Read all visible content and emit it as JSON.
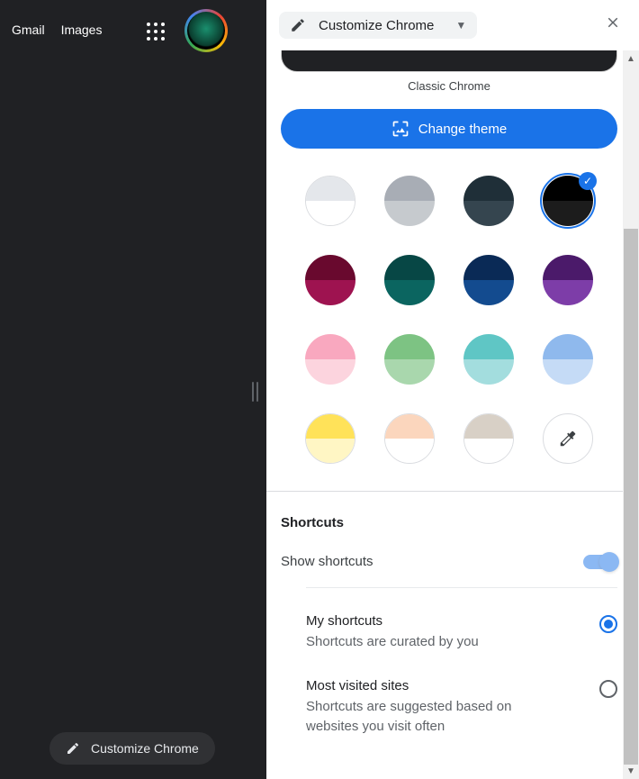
{
  "topnav": {
    "gmail": "Gmail",
    "images": "Images"
  },
  "customize_pill": "Customize Chrome",
  "panel": {
    "header_label": "Customize Chrome",
    "caption": "Classic Chrome",
    "change_theme": "Change theme",
    "shortcuts_title": "Shortcuts",
    "show_shortcuts": "Show shortcuts",
    "options": {
      "my_shortcuts_title": "My shortcuts",
      "my_shortcuts_desc": "Shortcuts are curated by you",
      "most_visited_title": "Most visited sites",
      "most_visited_desc": "Shortcuts are suggested based on websites you visit often"
    }
  },
  "swatches": [
    {
      "top": "#e4e7eb",
      "bot": "#ffffff",
      "outlined": true,
      "selected": false
    },
    {
      "top": "#a8adb5",
      "bot": "#c6cace",
      "outlined": false,
      "selected": false
    },
    {
      "top": "#1f2f38",
      "bot": "#35454f",
      "outlined": false,
      "selected": false
    },
    {
      "top": "#000000",
      "bot": "#1c1c1c",
      "outlined": false,
      "selected": true
    },
    {
      "top": "#69092e",
      "bot": "#9e1350",
      "outlined": false,
      "selected": false
    },
    {
      "top": "#074745",
      "bot": "#0b6560",
      "outlined": false,
      "selected": false
    },
    {
      "top": "#0a2a56",
      "bot": "#134b8f",
      "outlined": false,
      "selected": false
    },
    {
      "top": "#4b1a6a",
      "bot": "#7d3da8",
      "outlined": false,
      "selected": false
    },
    {
      "top": "#f9a8bf",
      "bot": "#fcd4de",
      "outlined": false,
      "selected": false
    },
    {
      "top": "#7dc383",
      "bot": "#a9d7ad",
      "outlined": false,
      "selected": false
    },
    {
      "top": "#5fc6c5",
      "bot": "#a3ddde",
      "outlined": false,
      "selected": false
    },
    {
      "top": "#8fb9ed",
      "bot": "#c5dbf6",
      "outlined": false,
      "selected": false
    },
    {
      "top": "#ffe259",
      "bot": "#fff6c4",
      "outlined": true,
      "selected": false
    },
    {
      "top": "#fbd6bd",
      "bot": "#ffffff",
      "outlined": true,
      "selected": false
    },
    {
      "top": "#d8d0c6",
      "bot": "#ffffff",
      "outlined": true,
      "selected": false
    }
  ]
}
